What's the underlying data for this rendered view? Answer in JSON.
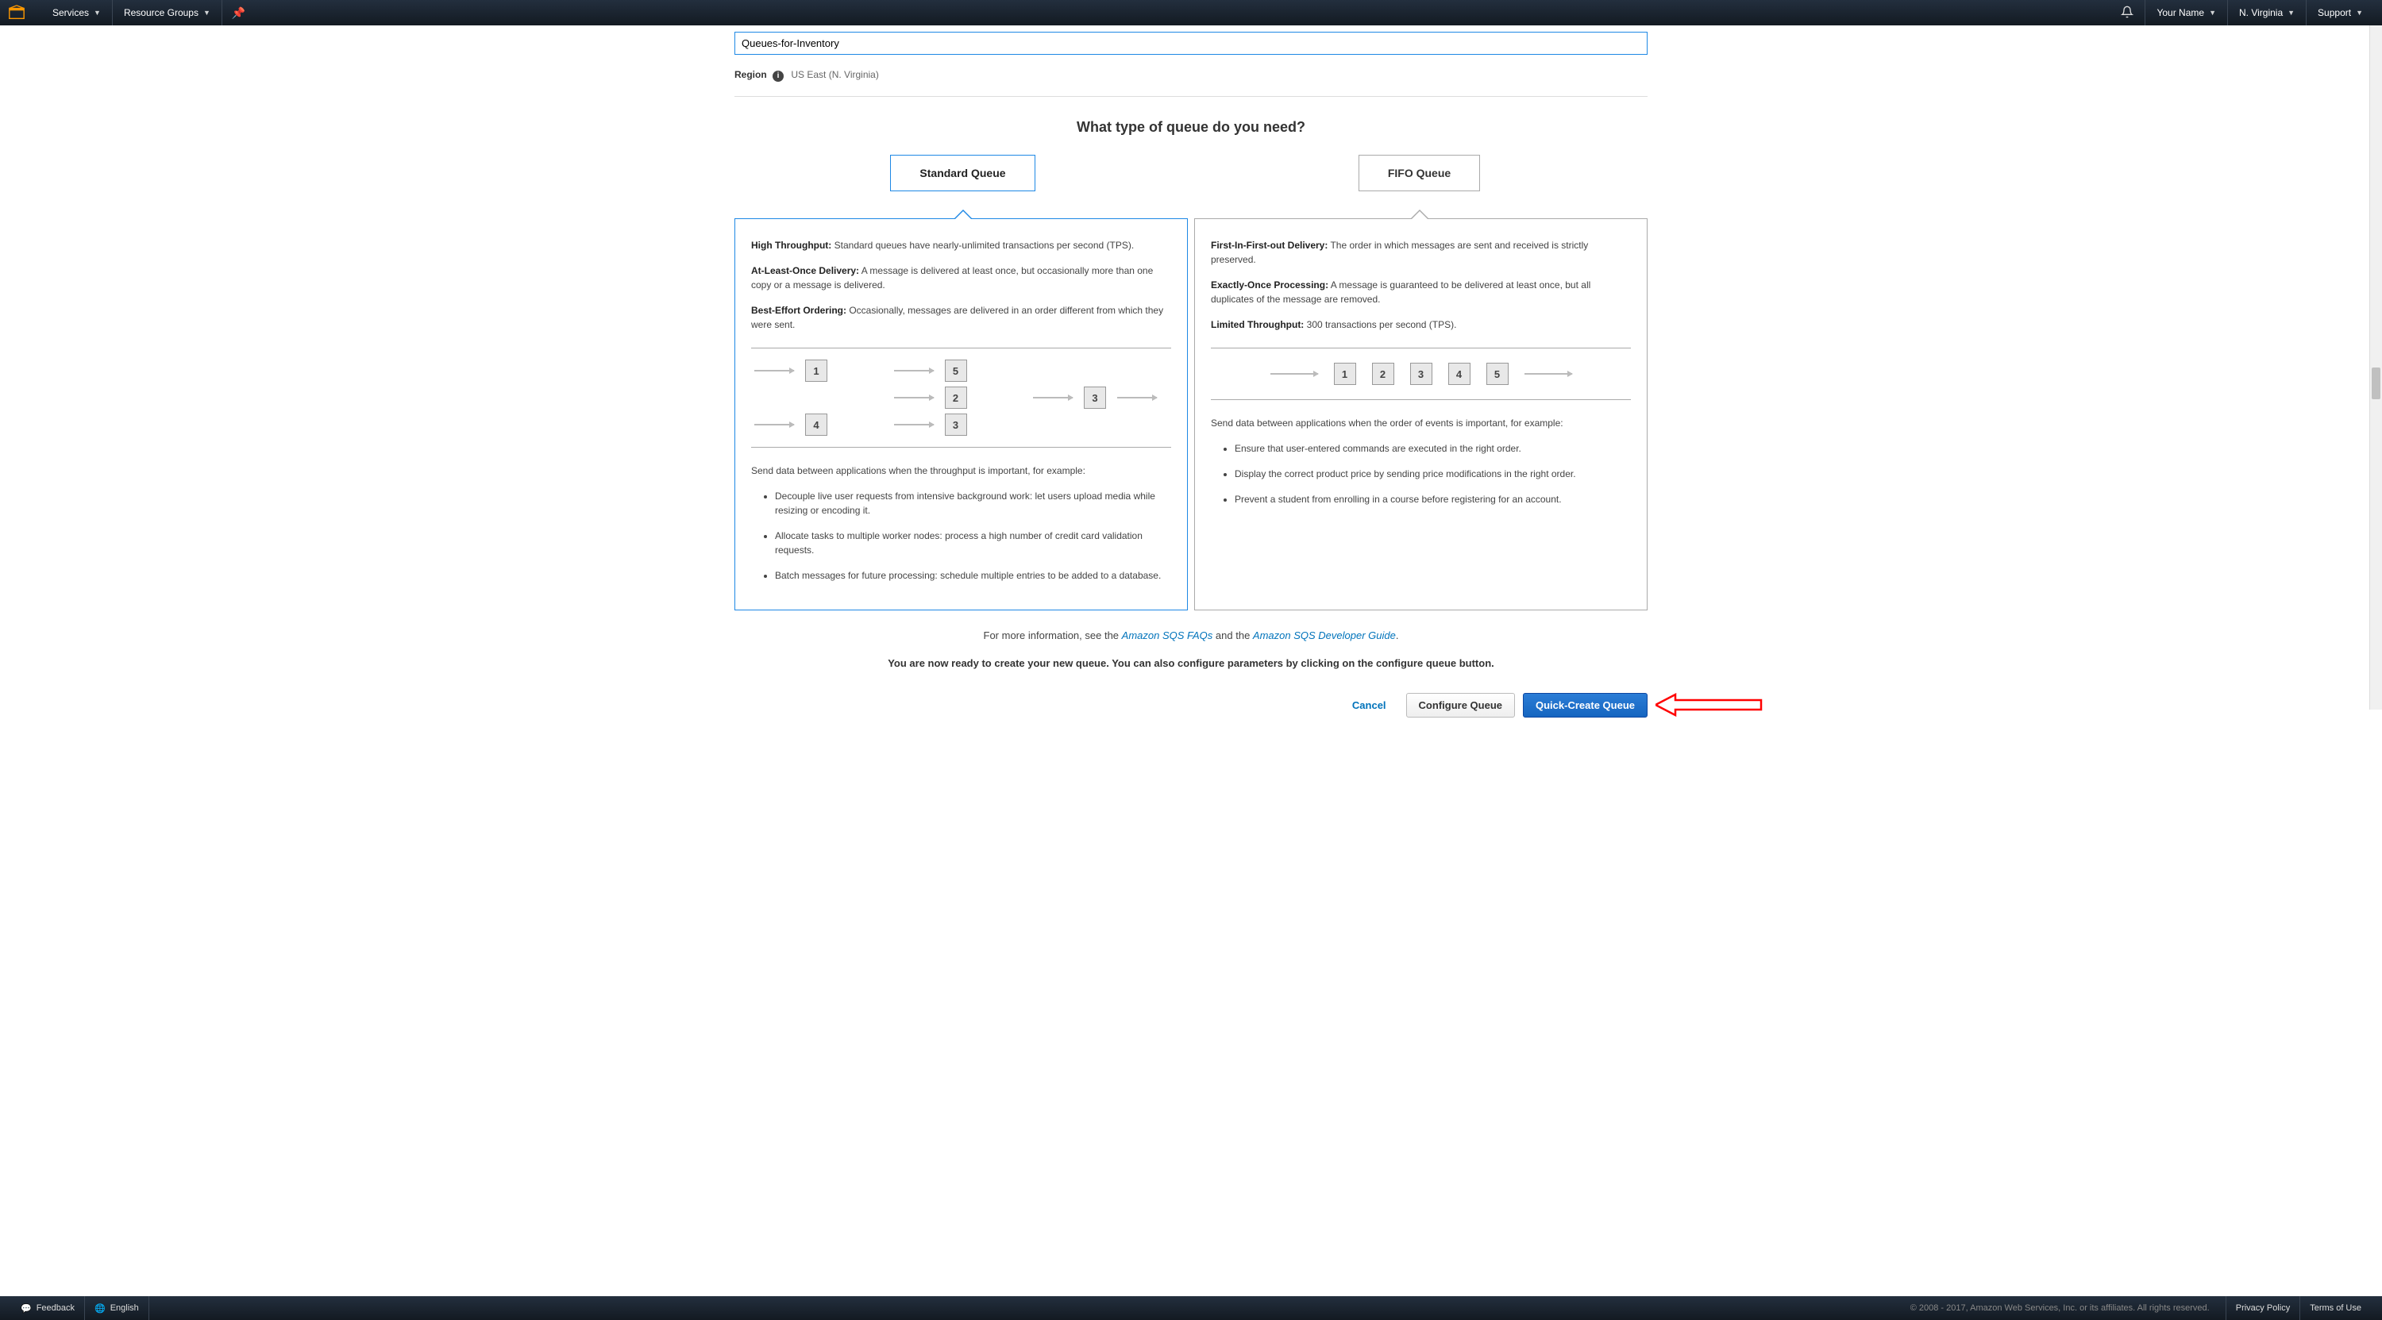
{
  "topnav": {
    "services": "Services",
    "resource_groups": "Resource Groups",
    "your_name": "Your Name",
    "region": "N. Virginia",
    "support": "Support"
  },
  "form": {
    "queue_name_value": "Queues-for-Inventory",
    "region_label": "Region",
    "region_value": "US East (N. Virginia)"
  },
  "heading": "What type of queue do you need?",
  "toggles": {
    "standard": "Standard Queue",
    "fifo": "FIFO Queue"
  },
  "standard": {
    "p1_label": "High Throughput:",
    "p1_text": " Standard queues have nearly-unlimited transactions per second (TPS).",
    "p2_label": "At-Least-Once Delivery:",
    "p2_text": " A message is delivered at least once, but occasionally more than one copy or a message is delivered.",
    "p3_label": "Best-Effort Ordering:",
    "p3_text": " Occasionally, messages are delivered in an order different from which they were sent.",
    "boxes_left": [
      "1",
      "4"
    ],
    "boxes_mid": [
      "5",
      "2",
      "3"
    ],
    "boxes_right": [
      "3"
    ],
    "use_intro": "Send data between applications when the throughput is important, for example:",
    "bullets": [
      "Decouple live user requests from intensive background work: let users upload media while resizing or encoding it.",
      "Allocate tasks to multiple worker nodes: process a high number of credit card validation requests.",
      "Batch messages for future processing: schedule multiple entries to be added to a database."
    ]
  },
  "fifo": {
    "p1_label": "First-In-First-out Delivery:",
    "p1_text": " The order in which messages are sent and received is strictly preserved.",
    "p2_label": "Exactly-Once Processing:",
    "p2_text": " A message is guaranteed to be delivered at least once, but all duplicates of the message are removed.",
    "p3_label": "Limited Throughput:",
    "p3_text": " 300 transactions per second (TPS).",
    "boxes": [
      "1",
      "2",
      "3",
      "4",
      "5"
    ],
    "use_intro": "Send data between applications when the order of events is important, for example:",
    "bullets": [
      "Ensure that user-entered commands are executed in the right order.",
      "Display the correct product price by sending price modifications in the right order.",
      "Prevent a student from enrolling in a course before registering for an account."
    ]
  },
  "info": {
    "prefix": "For more information, see the ",
    "link1": "Amazon SQS FAQs",
    "mid": " and the ",
    "link2": "Amazon SQS Developer Guide",
    "suffix": "."
  },
  "ready": "You are now ready to create your new queue. You can also configure parameters by clicking on the configure queue button.",
  "actions": {
    "cancel": "Cancel",
    "configure": "Configure Queue",
    "create": "Quick-Create Queue"
  },
  "footer": {
    "feedback": "Feedback",
    "english": "English",
    "copyright": "© 2008 - 2017, Amazon Web Services, Inc. or its affiliates. All rights reserved.",
    "privacy": "Privacy Policy",
    "terms": "Terms of Use"
  }
}
